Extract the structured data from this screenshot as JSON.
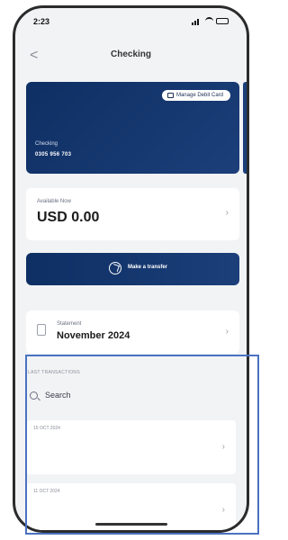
{
  "status_bar": {
    "time": "2:23"
  },
  "nav": {
    "back_glyph": "<",
    "title": "Checking"
  },
  "card": {
    "manage_label": "Manage Debit Card",
    "account_type": "Checking",
    "account_number": "0305 956 703",
    "colors": {
      "from": "#0e2f63",
      "to": "#1c3f7a"
    }
  },
  "balance": {
    "label": "Available Now",
    "amount": "USD 0.00"
  },
  "transfer": {
    "label": "Make a transfer"
  },
  "statement": {
    "label": "Statement",
    "value": "November 2024"
  },
  "transactions": {
    "heading": "LAST TRANSACTIONS",
    "search_placeholder": "Search",
    "items": [
      {
        "date": "15 OCT 2024"
      },
      {
        "date": "11 OCT 2024"
      }
    ]
  },
  "icons": [
    "back-chevron-icon",
    "signal-icon",
    "wifi-icon",
    "battery-icon",
    "card-icon",
    "transfer-icon",
    "document-icon",
    "search-icon",
    "chevron-right-icon"
  ],
  "accent_color": "#4a72c2"
}
